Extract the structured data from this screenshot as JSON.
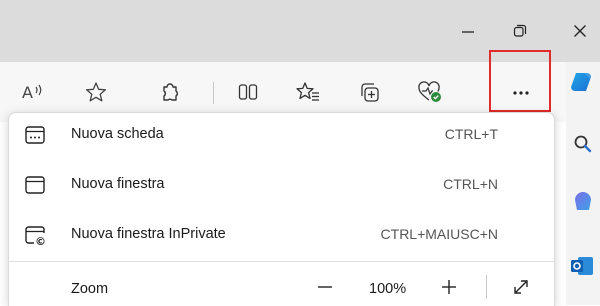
{
  "window_controls": {
    "minimize_icon": "minimize-icon",
    "restore_icon": "restore-icon",
    "close_icon": "close-icon"
  },
  "toolbar": {
    "icons": [
      "read-aloud-icon",
      "favorite-star-icon",
      "extensions-icon",
      "split-screen-icon",
      "favorites-list-icon",
      "collections-icon",
      "browser-essentials-icon",
      "settings-and-more-icon"
    ],
    "more_label": "···",
    "highlight_color": "#e12b2b"
  },
  "menu": {
    "items": [
      {
        "label": "Nuova scheda",
        "shortcut": "CTRL+T",
        "icon": "new-tab-icon"
      },
      {
        "label": "Nuova finestra",
        "shortcut": "CTRL+N",
        "icon": "new-window-icon"
      },
      {
        "label": "Nuova finestra InPrivate",
        "shortcut": "CTRL+MAIUSC+N",
        "icon": "inprivate-window-icon"
      }
    ],
    "zoom": {
      "label": "Zoom",
      "value": "100%",
      "decrease_icon": "minus-icon",
      "increase_icon": "plus-icon",
      "fullscreen_icon": "fullscreen-icon"
    }
  },
  "sidebar_pane": {
    "icons": [
      "copilot-icon",
      "search-icon",
      "games-icon",
      "outlook-icon"
    ]
  }
}
